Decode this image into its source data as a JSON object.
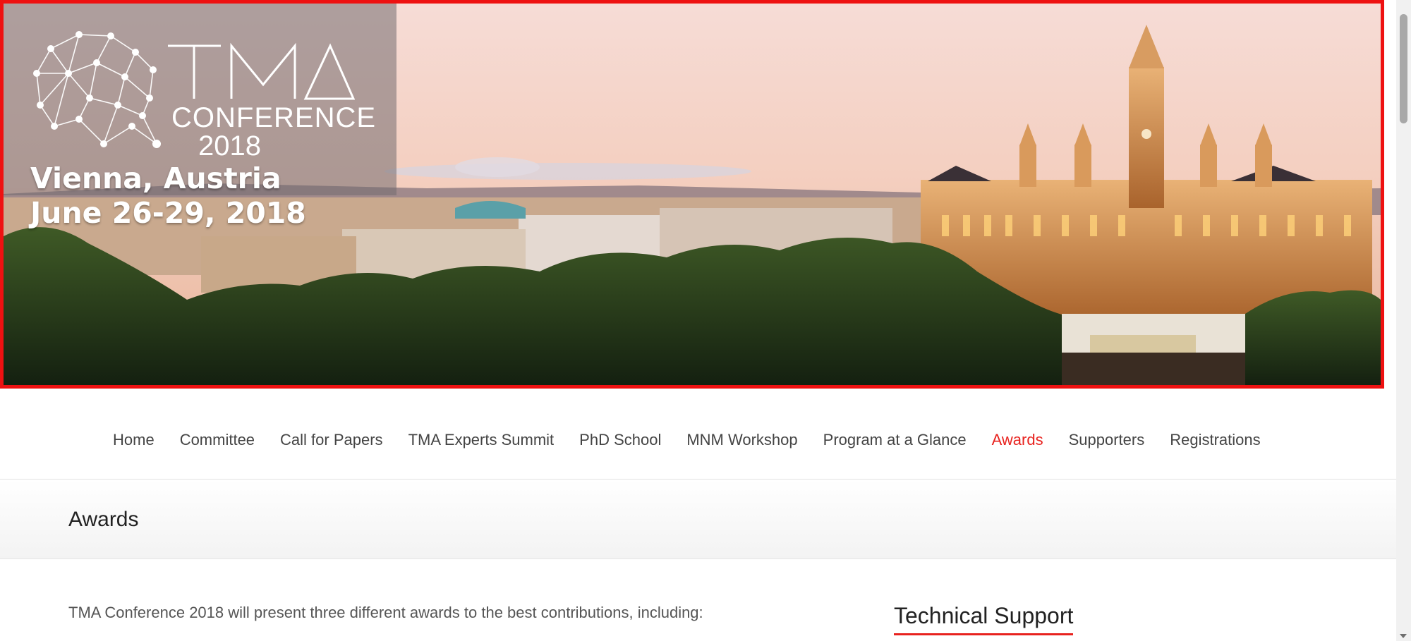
{
  "banner": {
    "logo_word": "TMA",
    "logo_conference": "CONFERENCE",
    "logo_year": "2018",
    "location": "Vienna, Austria",
    "dates": "June 26-29, 2018",
    "border_color": "#ee1111"
  },
  "nav": {
    "items": [
      {
        "label": "Home"
      },
      {
        "label": "Committee"
      },
      {
        "label": "Call for Papers"
      },
      {
        "label": "TMA Experts Summit"
      },
      {
        "label": "PhD School"
      },
      {
        "label": "MNM Workshop"
      },
      {
        "label": "Program at a Glance"
      },
      {
        "label": "Awards",
        "active": true
      },
      {
        "label": "Supporters"
      },
      {
        "label": "Registrations"
      }
    ],
    "active_color": "#e8221e"
  },
  "page": {
    "title": "Awards",
    "intro": "TMA Conference 2018 will present three different awards to the best contributions, including:"
  },
  "sidebar": {
    "widget_title": "Technical Support"
  }
}
